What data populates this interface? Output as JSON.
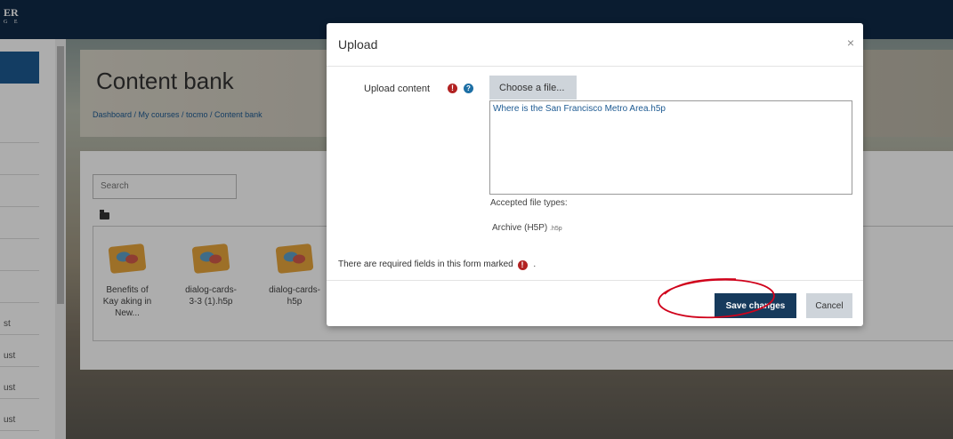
{
  "header": {
    "logo_main": "ER",
    "logo_sub": "G E"
  },
  "sidebar": {
    "items": [
      "st",
      "ust",
      "ust",
      "ust"
    ]
  },
  "page": {
    "title": "Content bank",
    "breadcrumb": "Dashboard / My courses / tocmo / Content bank"
  },
  "content_bank": {
    "search_placeholder": "Search",
    "files": [
      {
        "label": "Benefits of Kay aking in New..."
      },
      {
        "label": "dialog-cards-3-3 (1).h5p"
      },
      {
        "label": "dialog-cards-h5p"
      }
    ]
  },
  "modal": {
    "title": "Upload",
    "close_glyph": "×",
    "field_label": "Upload content",
    "required_glyph": "!",
    "help_glyph": "?",
    "choose_button": "Choose a file...",
    "selected_file": "Where is the San Francisco Metro Area.h5p",
    "accepted_label": "Accepted file types:",
    "archive_name": "Archive (H5P)",
    "archive_ext": ".h5p",
    "required_note": "There are required fields in this form marked",
    "required_note_end": ".",
    "save_button": "Save changes",
    "cancel_button": "Cancel"
  },
  "colors": {
    "topbar": "#0f2a47",
    "primary_button": "#163a5c",
    "secondary_button": "#ced4da",
    "required_icon": "#b22222",
    "help_icon": "#1d6fa5",
    "annotation": "#d0021b"
  },
  "icons": [
    "close-icon",
    "required-icon",
    "help-icon",
    "folder-icon",
    "h5p-file-icon"
  ]
}
